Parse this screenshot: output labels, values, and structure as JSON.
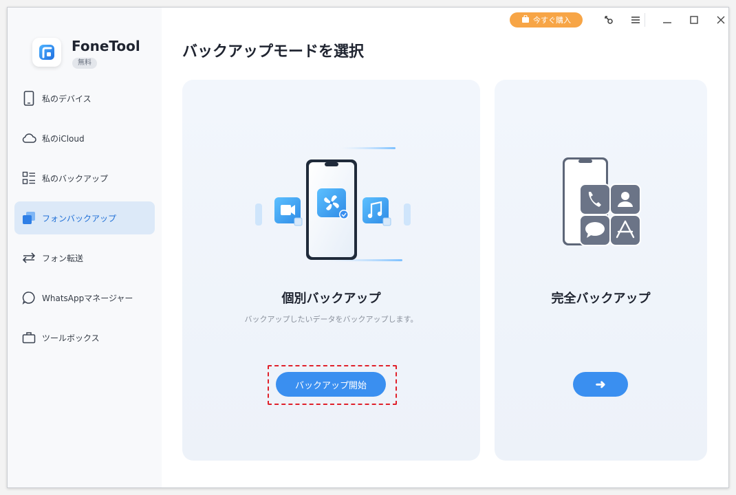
{
  "app": {
    "name": "FoneTool",
    "badge": "無料"
  },
  "titlebar": {
    "buy_label": "今すぐ購入",
    "icons": [
      "cart-icon",
      "key-icon",
      "menu-icon",
      "minimize-icon",
      "maximize-icon",
      "close-icon"
    ]
  },
  "sidebar": {
    "items": [
      {
        "label": "私のデバイス",
        "icon": "phone-icon",
        "active": false
      },
      {
        "label": "私のiCloud",
        "icon": "cloud-icon",
        "active": false
      },
      {
        "label": "私のバックアップ",
        "icon": "list-icon",
        "active": false
      },
      {
        "label": "フォンバックアップ",
        "icon": "backup-icon",
        "active": true
      },
      {
        "label": "フォン転送",
        "icon": "transfer-icon",
        "active": false
      },
      {
        "label": "WhatsAppマネージャー",
        "icon": "chat-icon",
        "active": false
      },
      {
        "label": "ツールボックス",
        "icon": "toolbox-icon",
        "active": false
      }
    ]
  },
  "main": {
    "title": "バックアップモードを選択",
    "cards": [
      {
        "title": "個別バックアップ",
        "description": "バックアップしたいデータをバックアップします。",
        "button_label": "バックアップ開始"
      },
      {
        "title": "完全バックアップ",
        "button_label": "➜"
      }
    ]
  },
  "colors": {
    "accent": "#3a8ff0",
    "buy": "#f7a546",
    "highlight": "#e0202a",
    "active_bg": "#dce9f8"
  }
}
